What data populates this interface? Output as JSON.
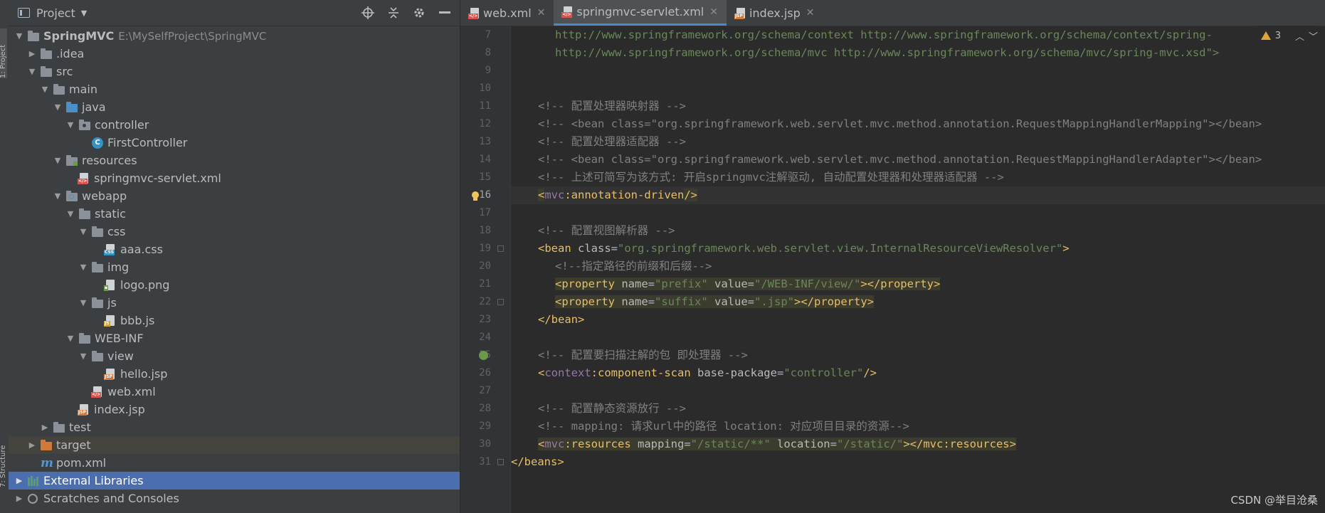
{
  "sidebar": {
    "project_tab": "1: Project",
    "structure_tab": "7: Structure"
  },
  "project_panel": {
    "title": "Project",
    "tree": [
      {
        "label": "SpringMVC",
        "path": "E:\\MySelfProject\\SpringMVC",
        "icon": "module-folder-icon"
      },
      {
        "label": ".idea",
        "icon": "folder-icon"
      },
      {
        "label": "src",
        "icon": "folder-icon"
      },
      {
        "label": "main",
        "icon": "folder-icon"
      },
      {
        "label": "java",
        "icon": "source-folder-icon"
      },
      {
        "label": "controller",
        "icon": "package-icon"
      },
      {
        "label": "FirstController",
        "icon": "class-icon"
      },
      {
        "label": "resources",
        "icon": "resources-folder-icon"
      },
      {
        "label": "springmvc-servlet.xml",
        "icon": "xml-file-icon"
      },
      {
        "label": "webapp",
        "icon": "web-folder-icon"
      },
      {
        "label": "static",
        "icon": "folder-icon"
      },
      {
        "label": "css",
        "icon": "folder-icon"
      },
      {
        "label": "aaa.css",
        "icon": "css-file-icon"
      },
      {
        "label": "img",
        "icon": "folder-icon"
      },
      {
        "label": "logo.png",
        "icon": "image-file-icon"
      },
      {
        "label": "js",
        "icon": "folder-icon"
      },
      {
        "label": "bbb.js",
        "icon": "js-file-icon"
      },
      {
        "label": "WEB-INF",
        "icon": "folder-icon"
      },
      {
        "label": "view",
        "icon": "folder-icon"
      },
      {
        "label": "hello.jsp",
        "icon": "jsp-file-icon"
      },
      {
        "label": "web.xml",
        "icon": "xml-file-icon"
      },
      {
        "label": "index.jsp",
        "icon": "jsp-file-icon"
      },
      {
        "label": "test",
        "icon": "folder-icon"
      },
      {
        "label": "target",
        "icon": "excluded-folder-icon"
      },
      {
        "label": "pom.xml",
        "icon": "maven-icon"
      },
      {
        "label": "External Libraries",
        "icon": "libraries-icon"
      },
      {
        "label": "Scratches and Consoles",
        "icon": "scratches-icon"
      }
    ]
  },
  "tabs": [
    {
      "label": "web.xml",
      "active": false
    },
    {
      "label": "springmvc-servlet.xml",
      "active": true
    },
    {
      "label": "index.jsp",
      "active": false
    }
  ],
  "inspection": {
    "warnings": "3"
  },
  "line_numbers": [
    "7",
    "8",
    "9",
    "10",
    "11",
    "12",
    "13",
    "14",
    "15",
    "16",
    "17",
    "18",
    "19",
    "20",
    "21",
    "22",
    "23",
    "24",
    "25",
    "26",
    "27",
    "28",
    "29",
    "30",
    "31"
  ],
  "code": {
    "l7": "http://www.springframework.org/schema/context http://www.springframework.org/schema/context/spring-",
    "l8": "http://www.springframework.org/schema/mvc http://www.springframework.org/schema/mvc/spring-mvc.xsd\">",
    "l11": "<!-- 配置处理器映射器 -->",
    "l12": "<!-- <bean class=\"org.springframework.web.servlet.mvc.method.annotation.RequestMappingHandlerMapping\"></bean>",
    "l13": "<!-- 配置处理器适配器 -->",
    "l14": "<!-- <bean class=\"org.springframework.web.servlet.mvc.method.annotation.RequestMappingHandlerAdapter\"></bean>",
    "l15": "<!-- 上述可简写为该方式: 开启springmvc注解驱动, 自动配置处理器和处理器适配器 -->",
    "l18": "<!-- 配置视图解析器 -->",
    "l20": "<!--指定路径的前缀和后缀-->",
    "l25": "<!-- 配置要扫描注解的包 即处理器 -->",
    "l28": "<!-- 配置静态资源放行 -->",
    "l29": "<!-- mapping: 请求url中的路径 location: 对应项目目录的资源-->",
    "l16_ns": "mvc",
    "l16_tag": ":annotation-driven",
    "l19_class": "\"org.springframework.web.servlet.view.InternalResourceViewResolver\"",
    "l21_name": "\"prefix\"",
    "l21_value": "\"/WEB-INF/view/\"",
    "l22_name": "\"suffix\"",
    "l22_value": "\".jsp\"",
    "l26_ns": "context",
    "l26_tag": ":component-scan",
    "l26_value": "\"controller\"",
    "l30_ns": "mvc",
    "l30_tag": ":resources",
    "l30_mapping": "\"/static/**\"",
    "l30_location": "\"/static/\"",
    "l31": "</beans>"
  },
  "watermark": "CSDN @举目沧桑"
}
